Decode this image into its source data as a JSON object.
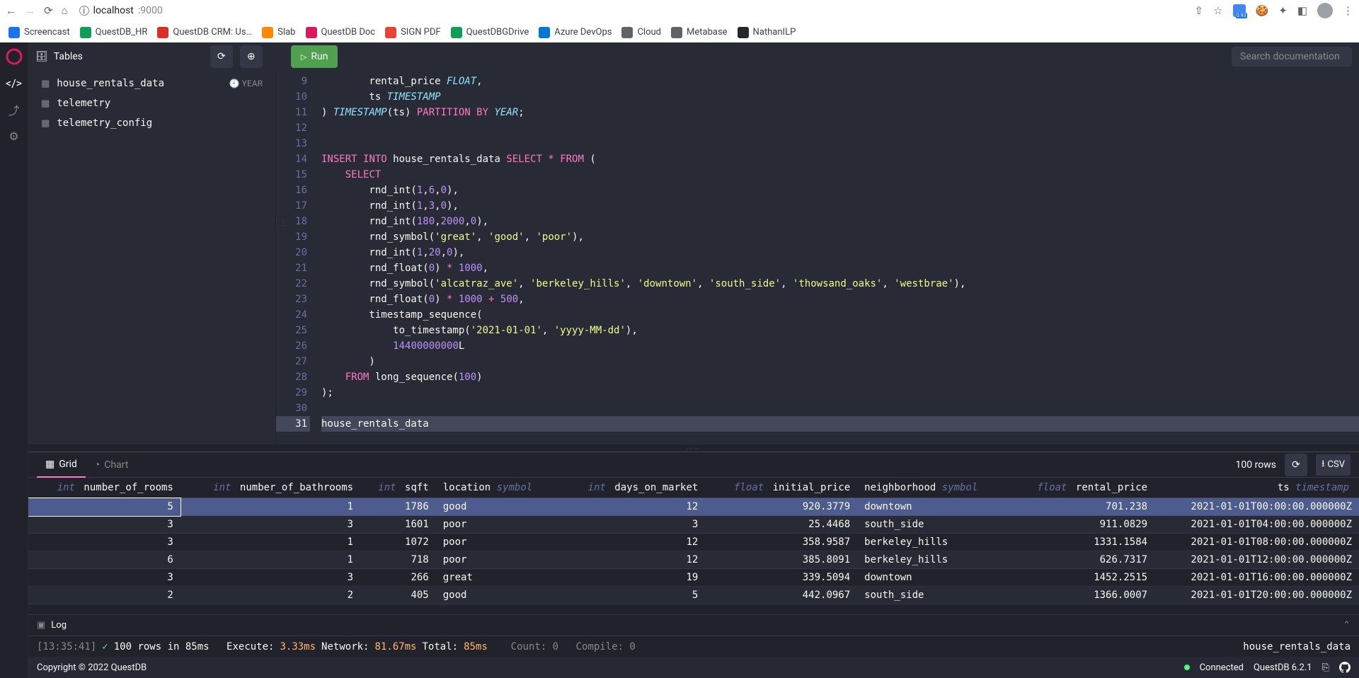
{
  "browser": {
    "url_host": "localhost",
    "url_port": ":9000",
    "bookmarks": [
      {
        "label": "Screencast",
        "color": "#1a73e8"
      },
      {
        "label": "QuestDB_HR",
        "color": "#0f9d58"
      },
      {
        "label": "QuestDB CRM: Us…",
        "color": "#d93025"
      },
      {
        "label": "Slab",
        "color": "#ff8a00"
      },
      {
        "label": "QuestDB Doc",
        "color": "#d81b60"
      },
      {
        "label": "SIGN PDF",
        "color": "#ea4335"
      },
      {
        "label": "QuestDBGDrive",
        "color": "#0f9d58"
      },
      {
        "label": "Azure DevOps",
        "color": "#0078d4"
      },
      {
        "label": "Cloud",
        "color": "#5f6368"
      },
      {
        "label": "Metabase",
        "color": "#5f6368"
      },
      {
        "label": "NathanILP",
        "color": "#24292e"
      }
    ]
  },
  "topbar": {
    "tables_label": "Tables",
    "run_label": "Run",
    "search_placeholder": "Search documentation"
  },
  "sidebar": {
    "tables": [
      {
        "name": "house_rentals_data",
        "partition": "YEAR"
      },
      {
        "name": "telemetry",
        "partition": ""
      },
      {
        "name": "telemetry_config",
        "partition": ""
      }
    ]
  },
  "editor": {
    "first_line_no": 9,
    "current_line_no": 31,
    "lines": [
      {
        "html": "        rental_price <span class='k-type'>FLOAT</span>,"
      },
      {
        "html": "        ts <span class='k-type'>TIMESTAMP</span>"
      },
      {
        "html": ") <span class='k-type'>TIMESTAMP</span>(ts) <span class='k-kw'>PARTITION</span> <span class='k-kw'>BY</span> <span class='k-type'>YEAR</span>;"
      },
      {
        "html": ""
      },
      {
        "html": ""
      },
      {
        "html": "<span class='k-kw'>INSERT</span> <span class='k-kw'>INTO</span> house_rentals_data <span class='k-kw'>SELECT</span> <span class='k-op'>*</span> <span class='k-kw'>FROM</span> ("
      },
      {
        "html": "    <span class='k-kw'>SELECT</span>"
      },
      {
        "html": "        rnd_int(<span class='k-num'>1</span>,<span class='k-num'>6</span>,<span class='k-num'>0</span>),"
      },
      {
        "html": "        rnd_int(<span class='k-num'>1</span>,<span class='k-num'>3</span>,<span class='k-num'>0</span>),"
      },
      {
        "html": "        rnd_int(<span class='k-num'>180</span>,<span class='k-num'>2000</span>,<span class='k-num'>0</span>),"
      },
      {
        "html": "        rnd_symbol(<span class='k-str'>'great'</span>, <span class='k-str'>'good'</span>, <span class='k-str'>'poor'</span>),"
      },
      {
        "html": "        rnd_int(<span class='k-num'>1</span>,<span class='k-num'>20</span>,<span class='k-num'>0</span>),"
      },
      {
        "html": "        rnd_float(<span class='k-num'>0</span>) <span class='k-op'>*</span> <span class='k-num'>1000</span>,"
      },
      {
        "html": "        rnd_symbol(<span class='k-str'>'alcatraz_ave'</span>, <span class='k-str'>'berkeley_hills'</span>, <span class='k-str'>'downtown'</span>, <span class='k-str'>'south_side'</span>, <span class='k-str'>'thowsand_oaks'</span>, <span class='k-str'>'westbrae'</span>),"
      },
      {
        "html": "        rnd_float(<span class='k-num'>0</span>) <span class='k-op'>*</span> <span class='k-num'>1000</span> <span class='k-op'>+</span> <span class='k-num'>500</span>,"
      },
      {
        "html": "        timestamp_sequence("
      },
      {
        "html": "            to_timestamp(<span class='k-str'>'2021-01-01'</span>, <span class='k-str'>'yyyy-MM-dd'</span>),"
      },
      {
        "html": "            <span class='k-num'>14400000000</span>L"
      },
      {
        "html": "        )"
      },
      {
        "html": "    <span class='k-kw'>FROM</span> long_sequence(<span class='k-num'>100</span>)"
      },
      {
        "html": ");"
      },
      {
        "html": ""
      },
      {
        "html": "<span class='hl-sel'>house_rentals_data</span>"
      }
    ]
  },
  "results": {
    "grid_tab": "Grid",
    "chart_tab": "Chart",
    "row_count": "100 rows",
    "csv_label": "CSV",
    "columns": [
      {
        "type": "int",
        "name": "number_of_rooms",
        "align": "r"
      },
      {
        "type": "int",
        "name": "number_of_bathrooms",
        "align": "r"
      },
      {
        "type": "int",
        "name": "sqft",
        "align": "r"
      },
      {
        "type": "symbol",
        "name": "location",
        "align": "l",
        "prefix": true
      },
      {
        "type": "int",
        "name": "days_on_market",
        "align": "r"
      },
      {
        "type": "float",
        "name": "initial_price",
        "align": "r"
      },
      {
        "type": "symbol",
        "name": "neighborhood",
        "align": "l",
        "prefix": true
      },
      {
        "type": "float",
        "name": "rental_price",
        "align": "r"
      },
      {
        "type": "timestamp",
        "name": "ts",
        "align": "r",
        "prefix": true
      }
    ],
    "rows": [
      {
        "sel": true,
        "cells": [
          "5",
          "1",
          "1786",
          "good",
          "12",
          "920.3779",
          "downtown",
          "701.238",
          "2021-01-01T00:00:00.000000Z"
        ]
      },
      {
        "cells": [
          "3",
          "3",
          "1601",
          "poor",
          "3",
          "25.4468",
          "south_side",
          "911.0829",
          "2021-01-01T04:00:00.000000Z"
        ]
      },
      {
        "cells": [
          "3",
          "1",
          "1072",
          "poor",
          "12",
          "358.9587",
          "berkeley_hills",
          "1331.1584",
          "2021-01-01T08:00:00.000000Z"
        ]
      },
      {
        "cells": [
          "6",
          "1",
          "718",
          "poor",
          "12",
          "385.8091",
          "berkeley_hills",
          "626.7317",
          "2021-01-01T12:00:00.000000Z"
        ]
      },
      {
        "cells": [
          "3",
          "3",
          "266",
          "great",
          "19",
          "339.5094",
          "downtown",
          "1452.2515",
          "2021-01-01T16:00:00.000000Z"
        ]
      },
      {
        "cells": [
          "2",
          "2",
          "405",
          "good",
          "5",
          "442.0967",
          "south_side",
          "1366.0007",
          "2021-01-01T20:00:00.000000Z"
        ]
      }
    ]
  },
  "log": {
    "label": "Log"
  },
  "stats": {
    "time": "[13:35:41]",
    "rows_msg": "100 rows in 85ms",
    "exec_label": "Execute:",
    "exec_val": "3.33ms",
    "net_label": "Network:",
    "net_val": "81.67ms",
    "tot_label": "Total:",
    "tot_val": "85ms",
    "count_label": "Count: 0",
    "compile_label": "Compile: 0",
    "table_name": "house_rentals_data"
  },
  "footer": {
    "copyright": "Copyright © 2022 QuestDB",
    "connected": "Connected",
    "version": "QuestDB 6.2.1"
  }
}
